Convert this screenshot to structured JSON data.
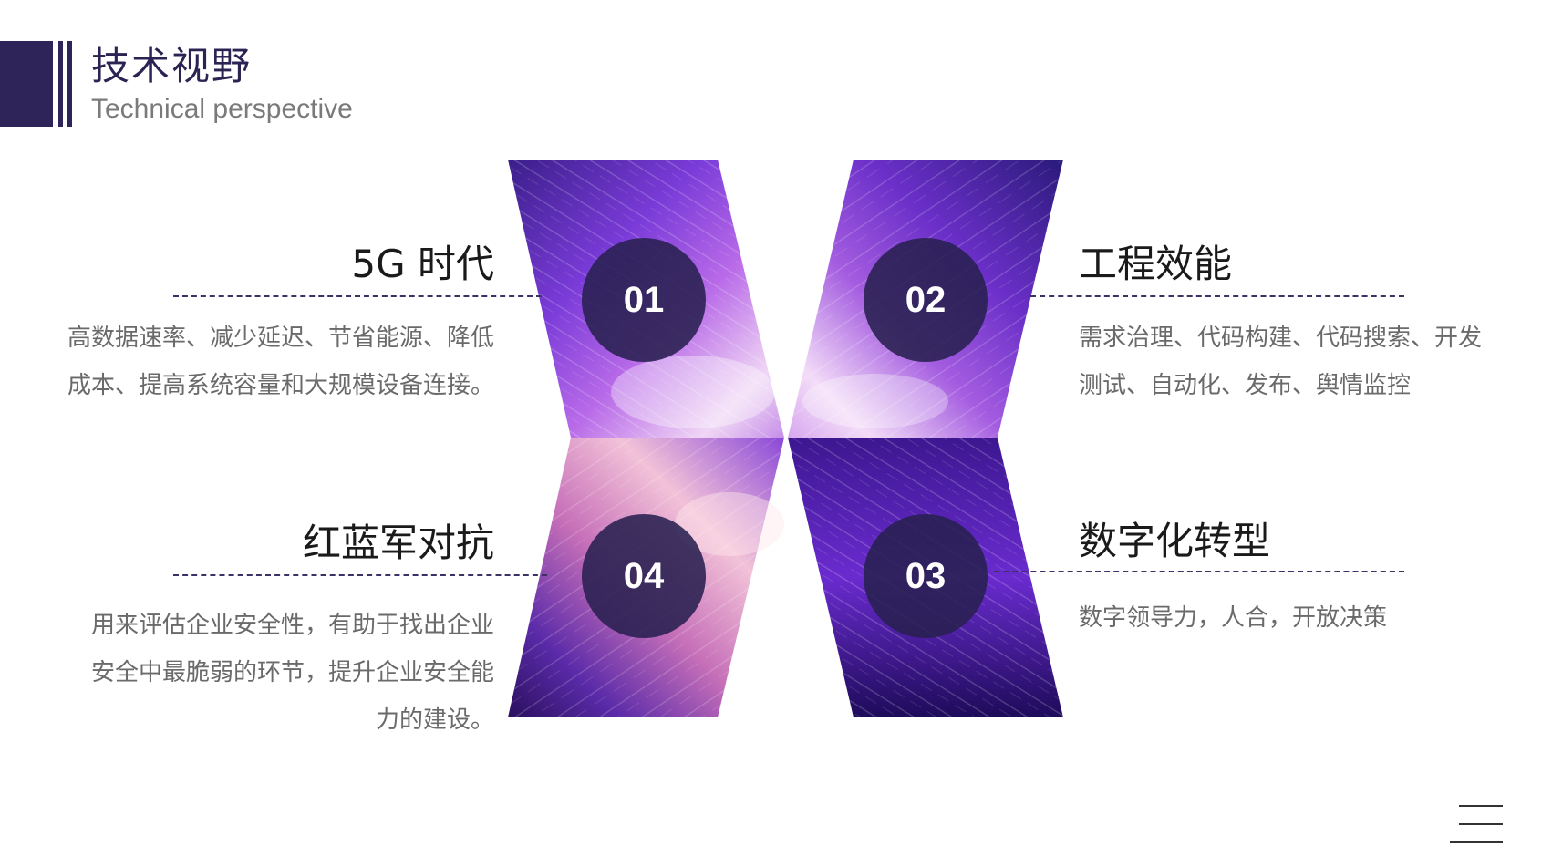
{
  "header": {
    "title": "技术视野",
    "subtitle": "Technical perspective"
  },
  "items": [
    {
      "number": "01",
      "title": "5G 时代",
      "lines": [
        "高数据速率、减少延迟、节省能源、降低",
        "成本、提高系统容量和大规模设备连接。"
      ]
    },
    {
      "number": "02",
      "title": "工程效能",
      "lines": [
        "需求治理、代码构建、代码搜索、开发",
        "测试、自动化、发布、舆情监控"
      ]
    },
    {
      "number": "03",
      "title": "数字化转型",
      "lines": [
        "数字领导力，人合，开放决策"
      ]
    },
    {
      "number": "04",
      "title": "红蓝军对抗",
      "lines": [
        "用来评估企业安全性，有助于找出企业",
        "安全中最脆弱的环节，提升企业安全能",
        "力的建设。"
      ]
    }
  ],
  "footer": {
    "icon": "menu-icon"
  },
  "colors": {
    "primary": "#2f2459",
    "circle": "#282050",
    "text": "#1a1a1a",
    "desc": "#6a6a6a"
  }
}
